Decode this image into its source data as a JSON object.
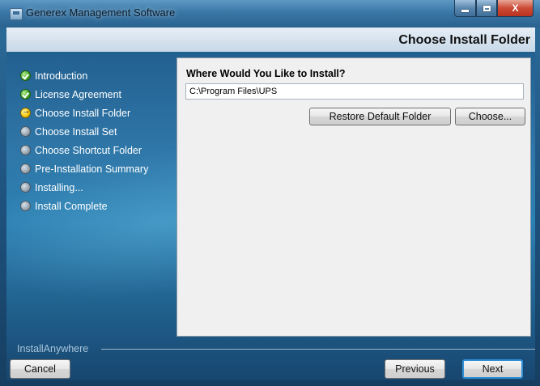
{
  "window": {
    "title": "Generex Management Software",
    "app_icon": "installer-icon",
    "controls": [
      "minimize-icon",
      "maximize-icon",
      "close-icon"
    ],
    "close_glyph": "X"
  },
  "header": {
    "title": "Choose Install Folder"
  },
  "steps": [
    {
      "label": "Introduction",
      "state": "done"
    },
    {
      "label": "License Agreement",
      "state": "done"
    },
    {
      "label": "Choose Install Folder",
      "state": "current"
    },
    {
      "label": "Choose Install Set",
      "state": "todo"
    },
    {
      "label": "Choose Shortcut Folder",
      "state": "todo"
    },
    {
      "label": "Pre-Installation Summary",
      "state": "todo"
    },
    {
      "label": "Installing...",
      "state": "todo"
    },
    {
      "label": "Install Complete",
      "state": "todo"
    }
  ],
  "main": {
    "question": "Where Would You Like to Install?",
    "path_value": "C:\\Program Files\\UPS",
    "restore_label": "Restore Default Folder",
    "choose_label": "Choose..."
  },
  "footer": {
    "brand": "InstallAnywhere",
    "cancel_label": "Cancel",
    "previous_label": "Previous",
    "next_label": "Next"
  },
  "colors": {
    "accent": "#2f8fd6",
    "step_done": "#3ea321",
    "step_current": "#f3c400",
    "step_todo": "#8c9aa6"
  }
}
